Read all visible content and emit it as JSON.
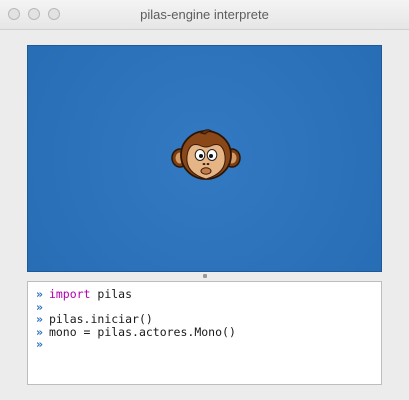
{
  "window": {
    "title": "pilas-engine interprete"
  },
  "stage": {
    "background_color": "#2a74c0",
    "actor_icon": "monkey-face-icon"
  },
  "console": {
    "prompt": "»",
    "lines": [
      {
        "keyword": "import",
        "text": " pilas"
      },
      {
        "keyword": "",
        "text": ""
      },
      {
        "keyword": "",
        "text": "pilas.iniciar()"
      },
      {
        "keyword": "",
        "text": "mono = pilas.actores.Mono()"
      },
      {
        "keyword": "",
        "text": ""
      }
    ]
  }
}
